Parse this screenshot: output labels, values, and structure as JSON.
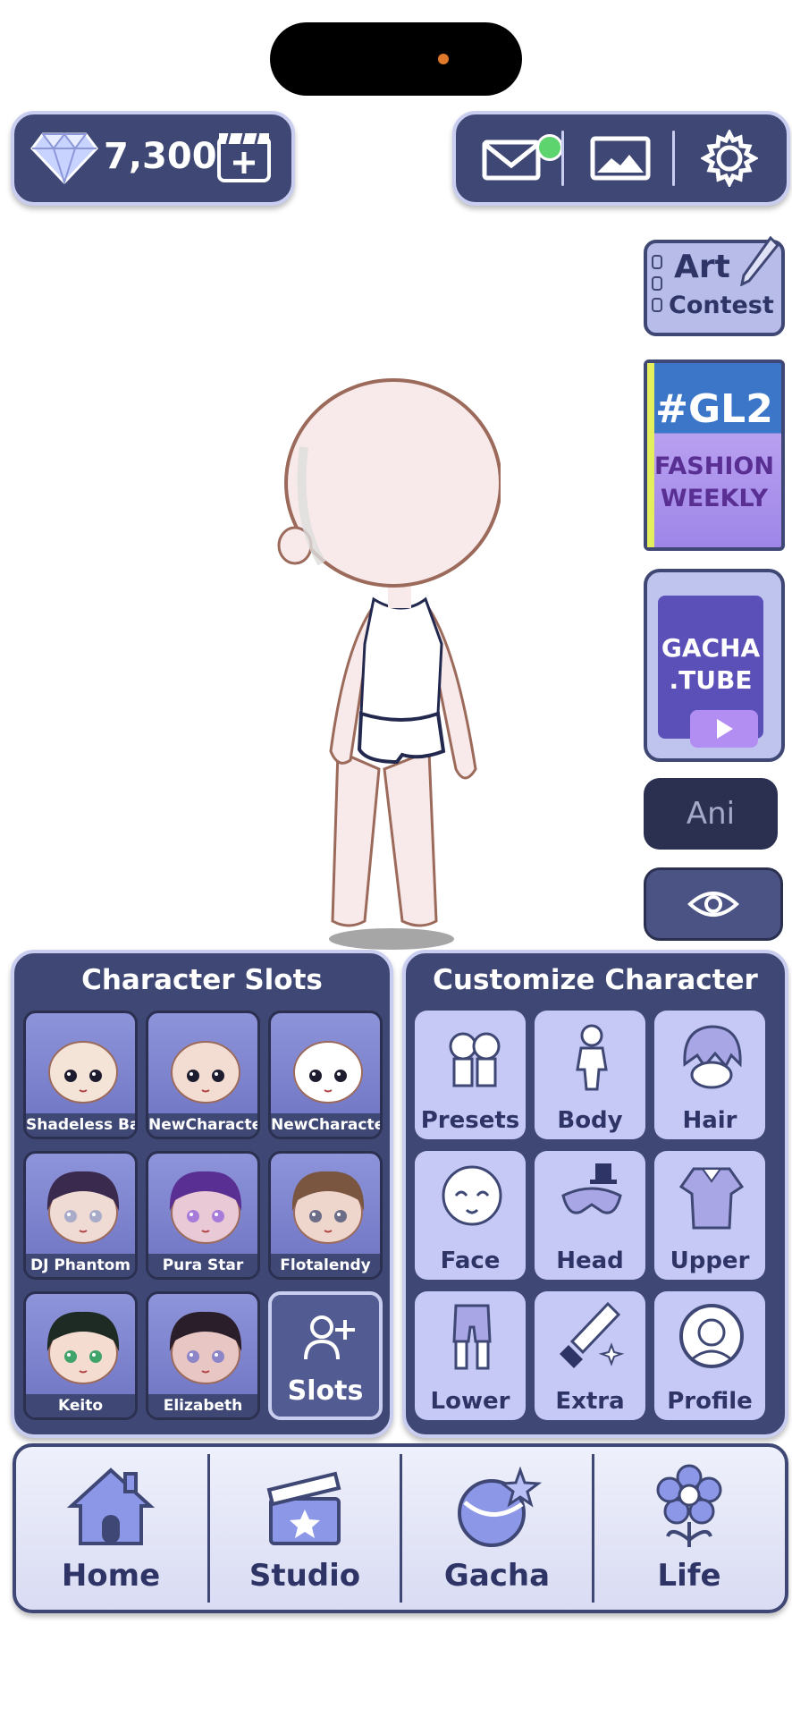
{
  "currency": {
    "gems": "7,300"
  },
  "side_buttons": {
    "art_contest": {
      "line1": "Art",
      "line2": "Contest"
    },
    "gl2": {
      "tag": "#GL2",
      "line1": "FASHION",
      "line2": "WEEKLY"
    },
    "gacha_tube": {
      "line1": "GACHA",
      "line2": ".TUBE"
    },
    "ani": "Ani"
  },
  "character_slots": {
    "title": "Character Slots",
    "slots": [
      {
        "name": "Shadeless Bas"
      },
      {
        "name": "NewCharacter"
      },
      {
        "name": "NewCharacter"
      },
      {
        "name": "DJ Phantom"
      },
      {
        "name": "Pura Star"
      },
      {
        "name": "Flotalendy"
      },
      {
        "name": "Keito"
      },
      {
        "name": "Elizabeth"
      }
    ],
    "add_label": "Slots"
  },
  "customize": {
    "title": "Customize Character",
    "items": [
      "Presets",
      "Body",
      "Hair",
      "Face",
      "Head",
      "Upper",
      "Lower",
      "Extra",
      "Profile"
    ]
  },
  "nav": {
    "home": "Home",
    "studio": "Studio",
    "gacha": "Gacha",
    "life": "Life"
  },
  "colors": {
    "panel": "#3f4775",
    "panel_border": "#c9cdef",
    "tile": "#c6c9f5",
    "notif": "#5ed46e"
  }
}
